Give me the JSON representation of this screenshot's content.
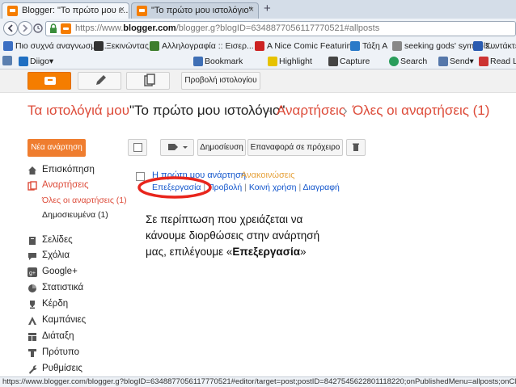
{
  "browser": {
    "tabs": [
      {
        "title": "Blogger: \"Το πρώτο μου ι...",
        "active": true
      },
      {
        "title": "\"Το πρώτο μου ιστολόγιο\"",
        "active": false
      }
    ],
    "new_tab": "+",
    "close_glyph": "×",
    "url_prefix": "https://www.",
    "url_domain": "blogger.com",
    "url_rest": "/blogger.g?blogID=6348877056117770521#allposts",
    "bookmarks": [
      "Πιο συχνά αναγνωσμέ...",
      "Ξεκινώντας",
      "Αλληλογραφία :: Εισερ...",
      "A Nice Comic Featurin...",
      "Τάξη Α",
      "seeking gods' symbols...",
      "Συντάκτες Ιστ"
    ],
    "toolbar_items": [
      "Diigo▾",
      "Bookmark",
      "Highlight",
      "Capture",
      "Search",
      "Send▾",
      "Read Later"
    ]
  },
  "blogger": {
    "view_blog": "Προβολή ιστολογίου",
    "breadcrumb": {
      "my_blogs": "Τα ιστολόγιά μου",
      "blog_title": "\"Το πρώτο μου ιστολόγιο\"",
      "sep1": "·",
      "posts": "Αναρτήσεις",
      "sep2": "›",
      "all_posts": "Όλες οι αναρτήσεις (1)"
    },
    "new_post": "Νέα ανάρτηση",
    "sidebar": {
      "overview": "Επισκόπηση",
      "posts": "Αναρτήσεις",
      "all_posts": "Όλες οι αναρτήσεις (1)",
      "published": "Δημοσιευμένα (1)",
      "items": [
        "Σελίδες",
        "Σχόλια",
        "Google+",
        "Στατιστικά",
        "Κέρδη",
        "Καμπάνιες",
        "Διάταξη",
        "Πρότυπο",
        "Ρυθμίσεις"
      ]
    },
    "actions": {
      "publish": "Δημοσίευση",
      "revert_draft": "Επαναφορά σε πρόχειρο"
    },
    "post": {
      "title": "Η πρώτη μου ανάρτηση",
      "author": "Ανακοινώσεις",
      "links": [
        "Επεξεργασία",
        "Προβολή",
        "Κοινή χρήση",
        "Διαγραφή"
      ],
      "link_sep": "|"
    }
  },
  "annotation": {
    "line1": "Σε περίπτωση που χρειάζεται να",
    "line2": "κάνουμε διορθώσεις στην ανάρτησή",
    "line3_prefix": "μας, επιλέγουμε «",
    "line3_bold": "Επεξεργασία",
    "line3_suffix": "»"
  },
  "status_bar": {
    "text": "https://www.blogger.com/blogger.g?blogID=6348877056117770521#editor/target=post;postID=8427545622801118220;onPublishedMenu=allposts;onClosedMenu=allposts"
  },
  "colors": {
    "blogger_orange": "#f57d00",
    "crumb_red": "#dd4b39",
    "link_blue": "#1155cc",
    "highlight_red": "#e8251c",
    "new_post_orange": "#ef7d2f"
  }
}
